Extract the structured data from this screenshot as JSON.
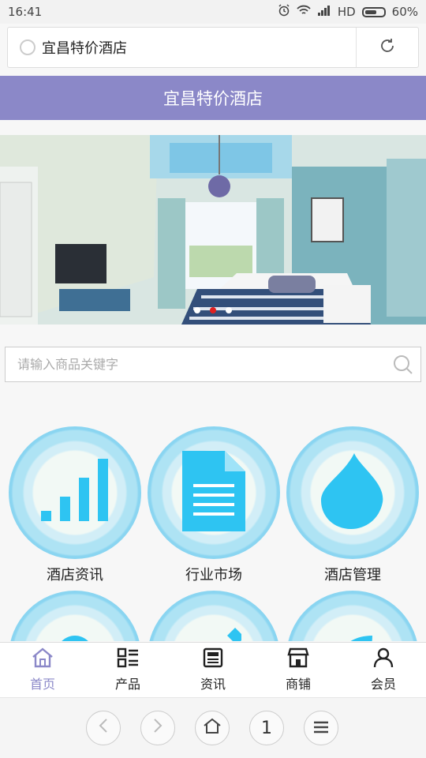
{
  "status": {
    "time": "16:41",
    "network": "HD",
    "battery": "60%"
  },
  "browser": {
    "url_title": "宜昌特价酒店"
  },
  "header": {
    "title": "宜昌特价酒店"
  },
  "banner": {
    "slide_count": 3,
    "active_slide": 2
  },
  "search": {
    "placeholder": "请输入商品关键字"
  },
  "grid": {
    "items": [
      {
        "label": "酒店资讯",
        "icon": "bar-chart-icon"
      },
      {
        "label": "行业市场",
        "icon": "document-icon"
      },
      {
        "label": "酒店管理",
        "icon": "drop-icon"
      },
      {
        "label": "",
        "icon": "helmet-icon"
      },
      {
        "label": "",
        "icon": "pencil-icon"
      },
      {
        "label": "",
        "icon": "leaf-icon"
      }
    ]
  },
  "tabbar": {
    "tabs": [
      {
        "label": "首页",
        "icon": "home-icon",
        "active": true
      },
      {
        "label": "产品",
        "icon": "grid-list-icon",
        "active": false
      },
      {
        "label": "资讯",
        "icon": "news-icon",
        "active": false
      },
      {
        "label": "商铺",
        "icon": "shop-icon",
        "active": false
      },
      {
        "label": "会员",
        "icon": "user-icon",
        "active": false
      }
    ]
  },
  "bottomnav": {
    "page_count": "1"
  },
  "colors": {
    "header_bg": "#8b88c8",
    "icon_blue": "#2ec4f2",
    "active_tab": "#8b88c8",
    "active_dot": "#e02020"
  }
}
